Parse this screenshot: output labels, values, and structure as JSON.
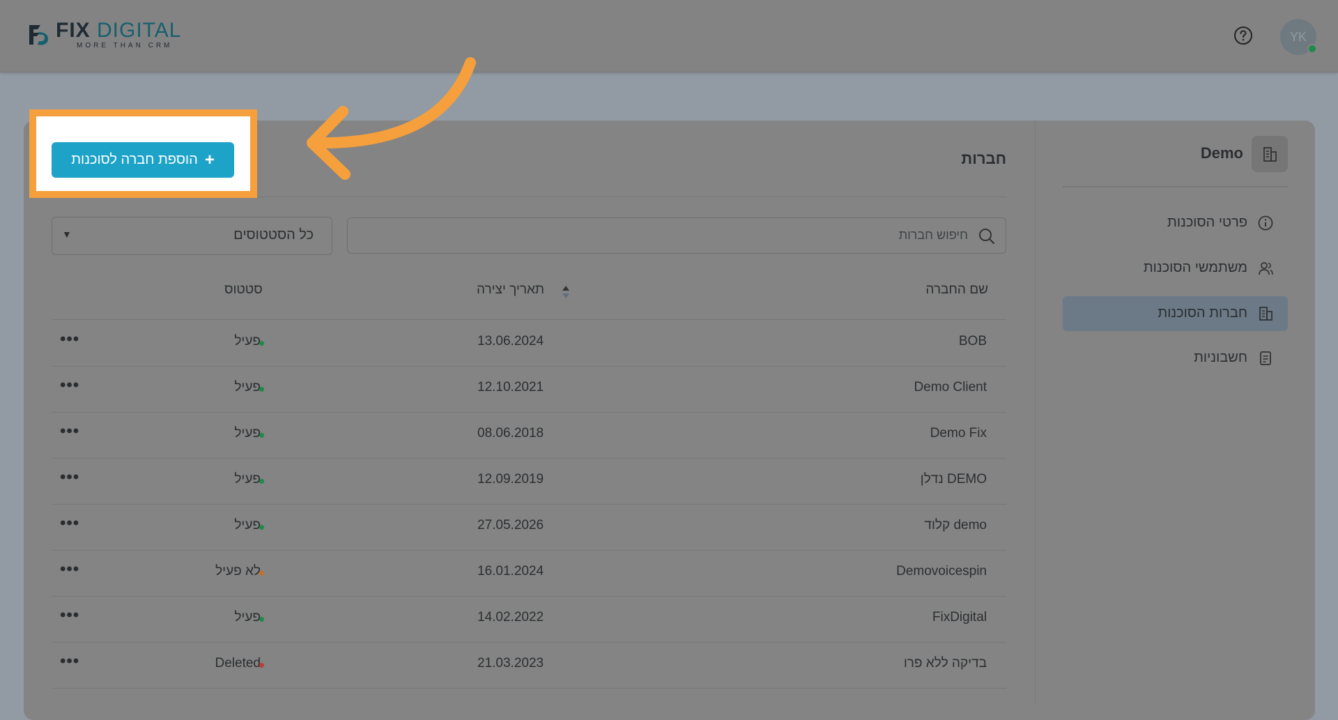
{
  "brand": {
    "title_a": "FIX",
    "title_b": "DIGITAL",
    "tagline": "MORE THAN CRM"
  },
  "header": {
    "avatar_initials": "YK",
    "help_icon": "question-circle-icon"
  },
  "sidebar": {
    "title": "Demo",
    "items": [
      {
        "label": "פרטי הסוכנות",
        "icon": "info-icon",
        "active": false
      },
      {
        "label": "משתמשי הסוכנות",
        "icon": "users-icon",
        "active": false
      },
      {
        "label": "חברות הסוכנות",
        "icon": "building-icon",
        "active": true
      },
      {
        "label": "חשבוניות",
        "icon": "document-icon",
        "active": false
      }
    ]
  },
  "main": {
    "title": "חברות",
    "add_button_label": "הוספת חברה לסוכנות",
    "search_placeholder": "חיפוש חברות",
    "status_filter_value": "כל הסטטוסים",
    "columns": {
      "name": "שם החברה",
      "created": "תאריך יצירה",
      "status": "סטטוס"
    },
    "rows": [
      {
        "name": "BOB",
        "created": "13.06.2024",
        "status": "פעיל",
        "status_color": "#1f8a4a"
      },
      {
        "name": "Demo Client",
        "created": "12.10.2021",
        "status": "פעיל",
        "status_color": "#1f8a4a"
      },
      {
        "name": "Demo Fix",
        "created": "08.06.2018",
        "status": "פעיל",
        "status_color": "#1f8a4a"
      },
      {
        "name": "DEMO נדלן",
        "created": "12.09.2019",
        "status": "פעיל",
        "status_color": "#1f8a4a"
      },
      {
        "name": "demo קלוד",
        "created": "27.05.2026",
        "status": "פעיל",
        "status_color": "#1f8a4a"
      },
      {
        "name": "Demovoicespin",
        "created": "16.01.2024",
        "status": "לא פעיל",
        "status_color": "#c2702a"
      },
      {
        "name": "FixDigital",
        "created": "14.02.2022",
        "status": "פעיל",
        "status_color": "#1f8a4a"
      },
      {
        "name": "בדיקה ללא פרו",
        "created": "21.03.2023",
        "status": "Deleted",
        "status_color": "#b8413a"
      }
    ]
  },
  "colors": {
    "accent": "#1ea3c8",
    "highlight": "#f5a03c"
  }
}
